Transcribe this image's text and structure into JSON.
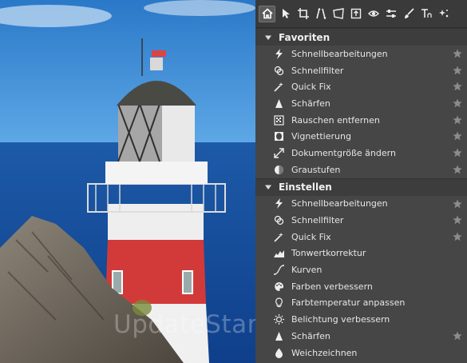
{
  "toolbar": {
    "icons": [
      "home-icon",
      "cursor-icon",
      "crop-icon",
      "straighten-icon",
      "perspective-icon",
      "export-icon",
      "eye-icon",
      "adjust-icon",
      "brush-icon",
      "text-icon",
      "sparkle-icon"
    ]
  },
  "sections": [
    {
      "title": "Favoriten",
      "items": [
        {
          "label": "Schnellbearbeitungen",
          "icon": "lightning-icon",
          "star": true
        },
        {
          "label": "Schnellfilter",
          "icon": "filter-icon",
          "star": true
        },
        {
          "label": "Quick Fix",
          "icon": "magic-wand-icon",
          "star": true
        },
        {
          "label": "Schärfen",
          "icon": "triangle-icon",
          "star": true
        },
        {
          "label": "Rauschen entfernen",
          "icon": "noise-icon",
          "star": true
        },
        {
          "label": "Vignettierung",
          "icon": "vignette-icon",
          "star": true
        },
        {
          "label": "Dokumentgröße ändern",
          "icon": "resize-icon",
          "star": true
        },
        {
          "label": "Graustufen",
          "icon": "grayscale-icon",
          "star": true
        }
      ]
    },
    {
      "title": "Einstellen",
      "items": [
        {
          "label": "Schnellbearbeitungen",
          "icon": "lightning-icon",
          "star": true
        },
        {
          "label": "Schnellfilter",
          "icon": "filter-icon",
          "star": true
        },
        {
          "label": "Quick Fix",
          "icon": "magic-wand-icon",
          "star": true
        },
        {
          "label": "Tonwertkorrektur",
          "icon": "levels-icon",
          "star": false
        },
        {
          "label": "Kurven",
          "icon": "curves-icon",
          "star": false
        },
        {
          "label": "Farben verbessern",
          "icon": "palette-icon",
          "star": false
        },
        {
          "label": "Farbtemperatur anpassen",
          "icon": "bulb-icon",
          "star": false
        },
        {
          "label": "Belichtung verbessern",
          "icon": "sun-icon",
          "star": false
        },
        {
          "label": "Schärfen",
          "icon": "triangle-icon",
          "star": true
        },
        {
          "label": "Weichzeichnen",
          "icon": "drop-icon",
          "star": false
        }
      ]
    }
  ],
  "watermark": "UpdateStar.com",
  "colors": {
    "panel": "#464646",
    "section": "#3d3d3d",
    "toolbar": "#3a3a3a",
    "star": "#8c8c8c"
  }
}
